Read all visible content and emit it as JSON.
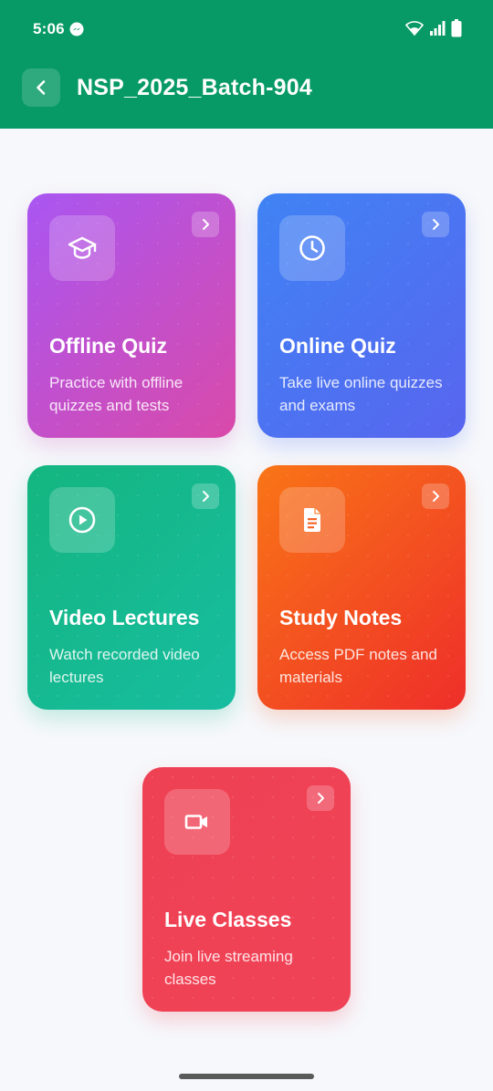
{
  "status_bar": {
    "time": "5:06",
    "icons": [
      "messenger-icon",
      "wifi-icon",
      "signal-icon",
      "battery-icon"
    ]
  },
  "header": {
    "title": "NSP_2025_Batch-904",
    "back_icon": "chevron-left-icon",
    "background_color": "#079a66"
  },
  "cards": [
    {
      "title": "Offline Quiz",
      "description": "Practice with offline quizzes and tests",
      "icon": "graduation-cap-icon",
      "colors": [
        "#a956f2",
        "#d94aa9"
      ]
    },
    {
      "title": "Online Quiz",
      "description": "Take live online quizzes and exams",
      "icon": "clock-icon",
      "colors": [
        "#3f83f5",
        "#5865ee"
      ]
    },
    {
      "title": "Video Lectures",
      "description": "Watch recorded video lectures",
      "icon": "play-circle-icon",
      "colors": [
        "#14b57f",
        "#17bda0"
      ]
    },
    {
      "title": "Study Notes",
      "description": "Access PDF notes and materials",
      "icon": "document-icon",
      "colors": [
        "#f97516",
        "#ee2e2a"
      ]
    },
    {
      "title": "Live Classes",
      "description": "Join live streaming classes",
      "icon": "video-camera-icon",
      "colors": [
        "#ef4154",
        "#f04256"
      ]
    }
  ]
}
